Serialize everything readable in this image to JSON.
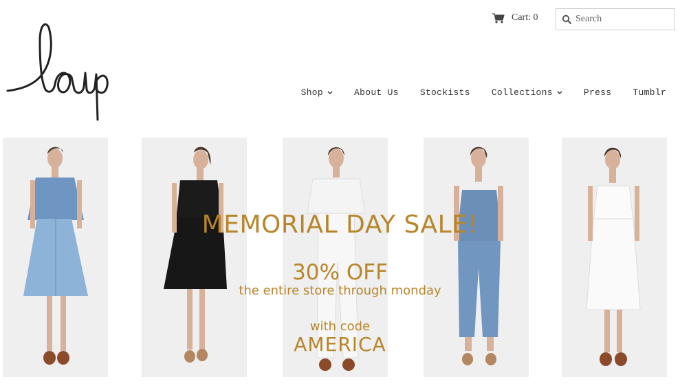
{
  "header": {
    "logo_text": "loup",
    "cart_label": "Cart: 0",
    "search_placeholder": "Search"
  },
  "nav": {
    "items": [
      {
        "label": "Shop",
        "has_dropdown": true
      },
      {
        "label": "About Us",
        "has_dropdown": false
      },
      {
        "label": "Stockists",
        "has_dropdown": false
      },
      {
        "label": "Collections",
        "has_dropdown": true
      },
      {
        "label": "Press",
        "has_dropdown": false
      },
      {
        "label": "Tumblr",
        "has_dropdown": false
      }
    ]
  },
  "promo": {
    "headline": "MEMORIAL DAY SALE!",
    "discount": "30% OFF",
    "detail": "the entire store through monday",
    "code_label": "with code",
    "code": "AMERICA",
    "color": "#b8862a"
  },
  "models": [
    {
      "outfit": "denim top and skirt"
    },
    {
      "outfit": "black button dress"
    },
    {
      "outfit": "white overalls"
    },
    {
      "outfit": "chambray jumpsuit"
    },
    {
      "outfit": "white sundress"
    }
  ]
}
